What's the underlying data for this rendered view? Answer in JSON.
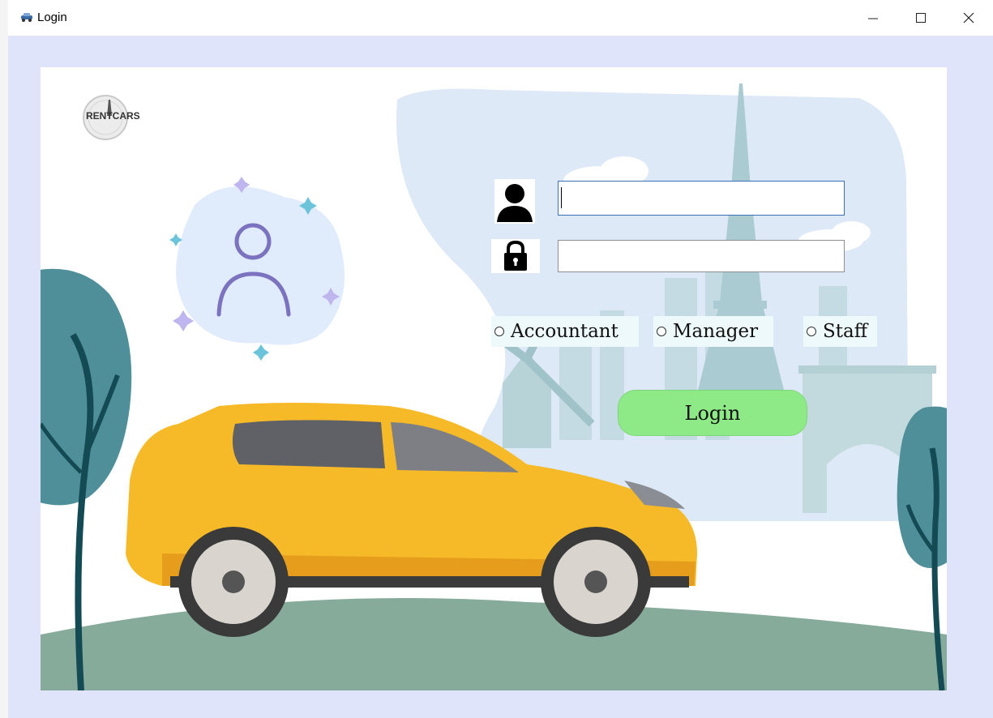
{
  "window": {
    "title": "Login",
    "minimize_icon": "minimize-icon",
    "maximize_icon": "maximize-icon",
    "close_icon": "close-icon"
  },
  "logo": {
    "text": "RENTCARS"
  },
  "form": {
    "username_value": "",
    "password_value": "",
    "username_icon": "user-icon",
    "password_icon": "lock-icon",
    "roles": [
      {
        "label": "Accountant",
        "selected": false
      },
      {
        "label": "Manager",
        "selected": false
      },
      {
        "label": "Staff",
        "selected": false
      }
    ],
    "login_label": "Login"
  },
  "colors": {
    "window_background": "#e0e4fb",
    "login_button": "#8eea86",
    "car_body": "#f6b928",
    "tree": "#4f8f99",
    "ground": "#86ab9a",
    "city_background": "#dde9f6"
  }
}
